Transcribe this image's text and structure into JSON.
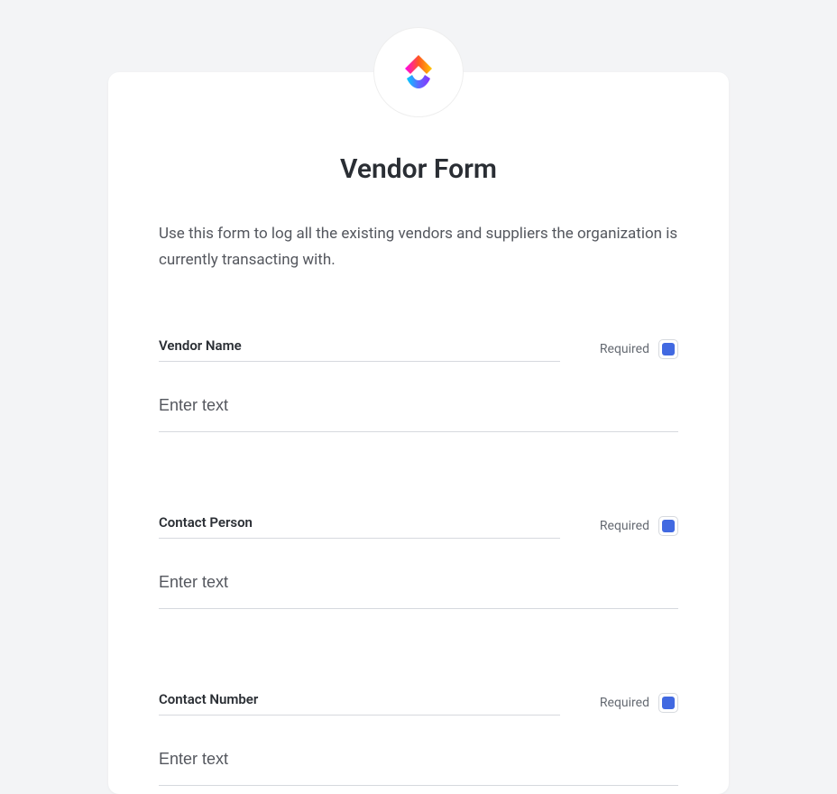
{
  "form": {
    "title": "Vendor Form",
    "description": "Use this form to log all the existing vendors and suppliers the organization is currently transacting with.",
    "fields": [
      {
        "label": "Vendor Name",
        "placeholder": "Enter text",
        "required_label": "Required",
        "required": true
      },
      {
        "label": "Contact Person",
        "placeholder": "Enter text",
        "required_label": "Required",
        "required": true
      },
      {
        "label": "Contact Number",
        "placeholder": "Enter text",
        "required_label": "Required",
        "required": true
      }
    ]
  }
}
